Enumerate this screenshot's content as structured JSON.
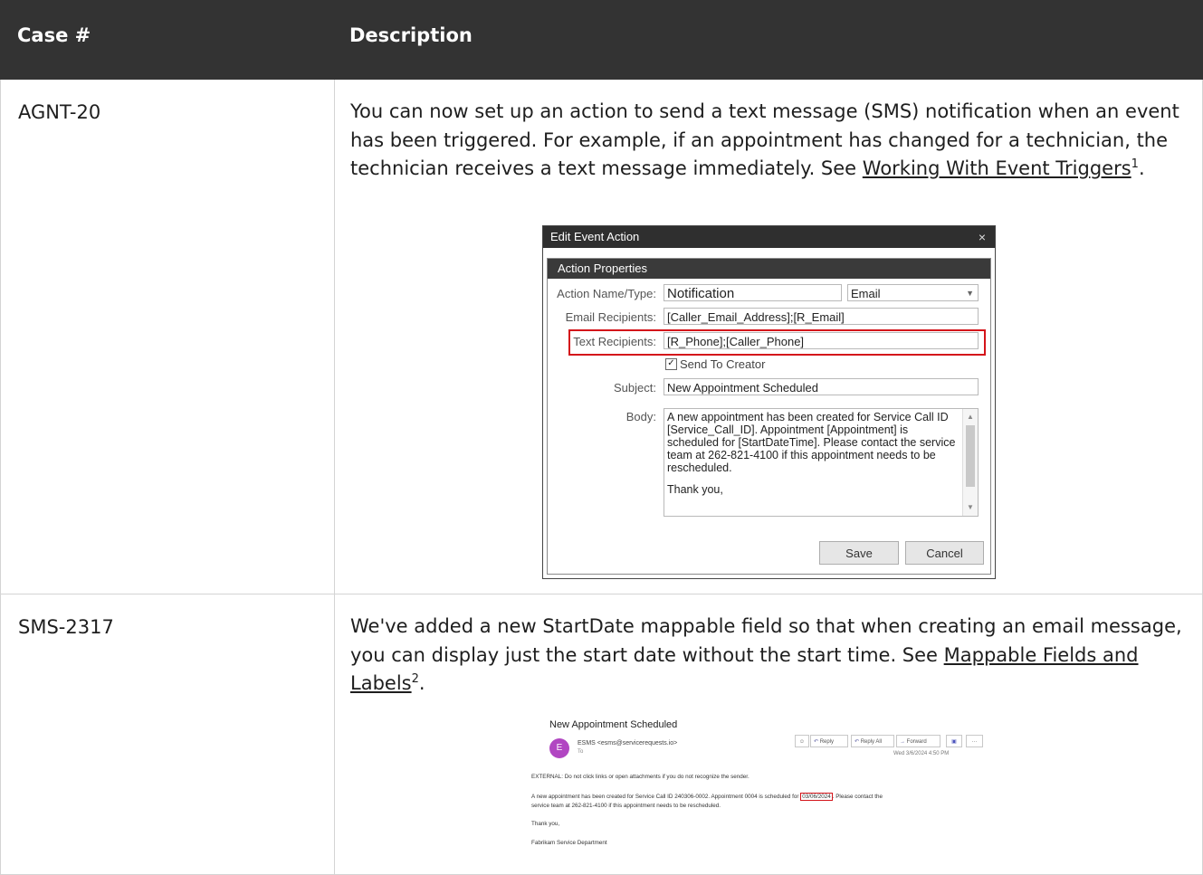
{
  "table": {
    "headers": [
      "Case #",
      "Description"
    ],
    "rows": [
      {
        "case": "AGNT-20",
        "text": "You can now set up an action to send a text message (SMS) notification when an event has been triggered. For example, if an appointment has changed for a technician, the technician receives a text message immediately. See ",
        "link": "Working With Event Triggers",
        "sup": "1",
        "tail": "."
      },
      {
        "case": "SMS-2317",
        "text": "We've added a new StartDate mappable field so that when creating an email message, you can display just the start date without the start time. See ",
        "link": "Mappable Fields and Labels",
        "sup": "2",
        "tail": "."
      }
    ]
  },
  "dialog": {
    "title": "Edit Event Action",
    "close": "×",
    "section": "Action Properties",
    "action_label": "Action Name/Type:",
    "action_name": "Notification",
    "action_type": "Email",
    "email_label": "Email Recipients:",
    "email_value": "[Caller_Email_Address];[R_Email]",
    "text_label": "Text Recipients:",
    "text_value": "[R_Phone];[Caller_Phone]",
    "send_label": "Send To Creator",
    "send_checked": "✓",
    "subject_label": "Subject:",
    "subject_value": "New Appointment Scheduled",
    "body_label": "Body:",
    "body_value": "A new appointment has been created for Service Call ID [Service_Call_ID].  Appointment [Appointment] is scheduled for [StartDateTime].  Please contact the service team at 262-821-4100 if this appointment needs to be rescheduled.",
    "body_thanks": "Thank you,",
    "save": "Save",
    "cancel": "Cancel"
  },
  "email": {
    "subject": "New Appointment Scheduled",
    "avatar": "E",
    "from": "ESMS <esms@servicerequests.io>",
    "to": "To",
    "emoji": "☺",
    "reply": "Reply",
    "reply_all": "Reply All",
    "forward": "Forward",
    "more": "···",
    "date": "Wed 3/6/2024 4:50 PM",
    "warning": "EXTERNAL: Do not click links or open attachments if you do not recognize the sender.",
    "body1a": "A new appointment has been created for Service Call ID 240306-0002.  Appointment 0004 is scheduled for ",
    "body1date": "03/06/2024",
    "body1b": ".  Please contact the",
    "body2": "service team at 262-821-4100 if this appointment needs to be rescheduled.",
    "thanks": "Thank you,",
    "signature": "Fabrikam Service Department"
  }
}
